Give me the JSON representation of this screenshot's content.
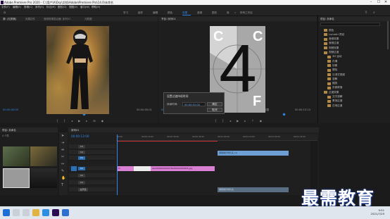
{
  "window": {
    "title": "Adobe Premiere Pro 2020 - C:\\用户\\A\\Dsy\\文档\\Adobe\\Premiere Pro\\14.0\\未命名",
    "controls": [
      "–",
      "☐",
      "✕"
    ]
  },
  "menu": [
    "文件(F)",
    "编辑(E)",
    "剪辑(C)",
    "序列(S)",
    "标记(M)",
    "图形(G)",
    "视图(V)",
    "窗口(W)",
    "帮助(H)"
  ],
  "workspaces": {
    "items": [
      "学习",
      "组件",
      "编辑",
      "颜色",
      "效果",
      "音频",
      "图形",
      "库",
      "»"
    ],
    "active_index": 4,
    "extra": "所有工作区"
  },
  "source_monitor": {
    "tabs": [
      "源: (无剪辑)",
      "效果控件",
      "音频剪辑混合器: 序列01",
      "元数据"
    ],
    "timecode_left": "00:00:00:00",
    "timecode_right": "00:00:00:01"
  },
  "program_monitor": {
    "tab": "节目: 序列01",
    "timecode_left": "00:00:00:00",
    "fit": "适合",
    "quality": "完整",
    "timecode_right": "00:00:15:13",
    "leader_number": "4",
    "leader_corners": [
      "C",
      "C",
      "F",
      "F"
    ]
  },
  "dialog": {
    "title": "设置过渡持续时间",
    "label": "持续时间:",
    "value": "00:00:01:00",
    "ok": "确定",
    "cancel": "取消"
  },
  "project_panel": {
    "header": "项目: 未命名",
    "items": [
      {
        "label": "颜色",
        "type": "folder"
      },
      {
        "label": "Lumetri 预设",
        "type": "folder"
      },
      {
        "label": "音频效果",
        "type": "folder"
      },
      {
        "label": "音频过渡",
        "type": "folder"
      },
      {
        "label": "视频效果",
        "type": "folder"
      },
      {
        "label": "视频过渡",
        "type": "folder"
      },
      {
        "label": "3D 运动",
        "type": "folder"
      },
      {
        "label": "内滑",
        "type": "folder"
      },
      {
        "label": "划像",
        "type": "folder"
      },
      {
        "label": "擦除",
        "type": "folder"
      },
      {
        "label": "沉浸式视频",
        "type": "folder"
      },
      {
        "label": "溶解",
        "type": "folder"
      },
      {
        "label": "缩放",
        "type": "folder"
      },
      {
        "label": "页面剥落",
        "type": "folder"
      },
      {
        "label": "过渡效果",
        "type": "folder"
      },
      {
        "label": "交叉溶解",
        "type": "folder"
      },
      {
        "label": "黑场过渡",
        "type": "folder"
      },
      {
        "label": "白场过渡",
        "type": "folder"
      }
    ]
  },
  "bin": {
    "tab": "项目: 未命名",
    "item_count": "4 个项"
  },
  "timeline": {
    "tab": "序列01",
    "timecode": "00:00:13:00",
    "ruler": [
      "00:00",
      "00:00:15:00",
      "00:00:30:00",
      "00:00:45:00",
      "00:01:00:00",
      "00:01:15:00",
      "00:01:30:00",
      "00:01:45:00"
    ],
    "tracks": [
      "V3",
      "V2",
      "V1",
      "A1",
      "A2",
      "A3",
      "主声道"
    ],
    "clips": {
      "v2_label": "通用倒计时片头 (1)",
      "v1_a": "fx",
      "v1_b": "ab1000000000078200000000fbf5.jpg",
      "a1": "通用倒计时片头"
    }
  },
  "watermark": "最需教育",
  "taskbar": {
    "time": "9:51",
    "date": "2021/7/29"
  },
  "colors": {
    "accent": "#2d8ceb",
    "clip_video": "#6d9fd4",
    "clip_image": "#d97fd2",
    "watermark_shadow": "#1a3d9a"
  }
}
